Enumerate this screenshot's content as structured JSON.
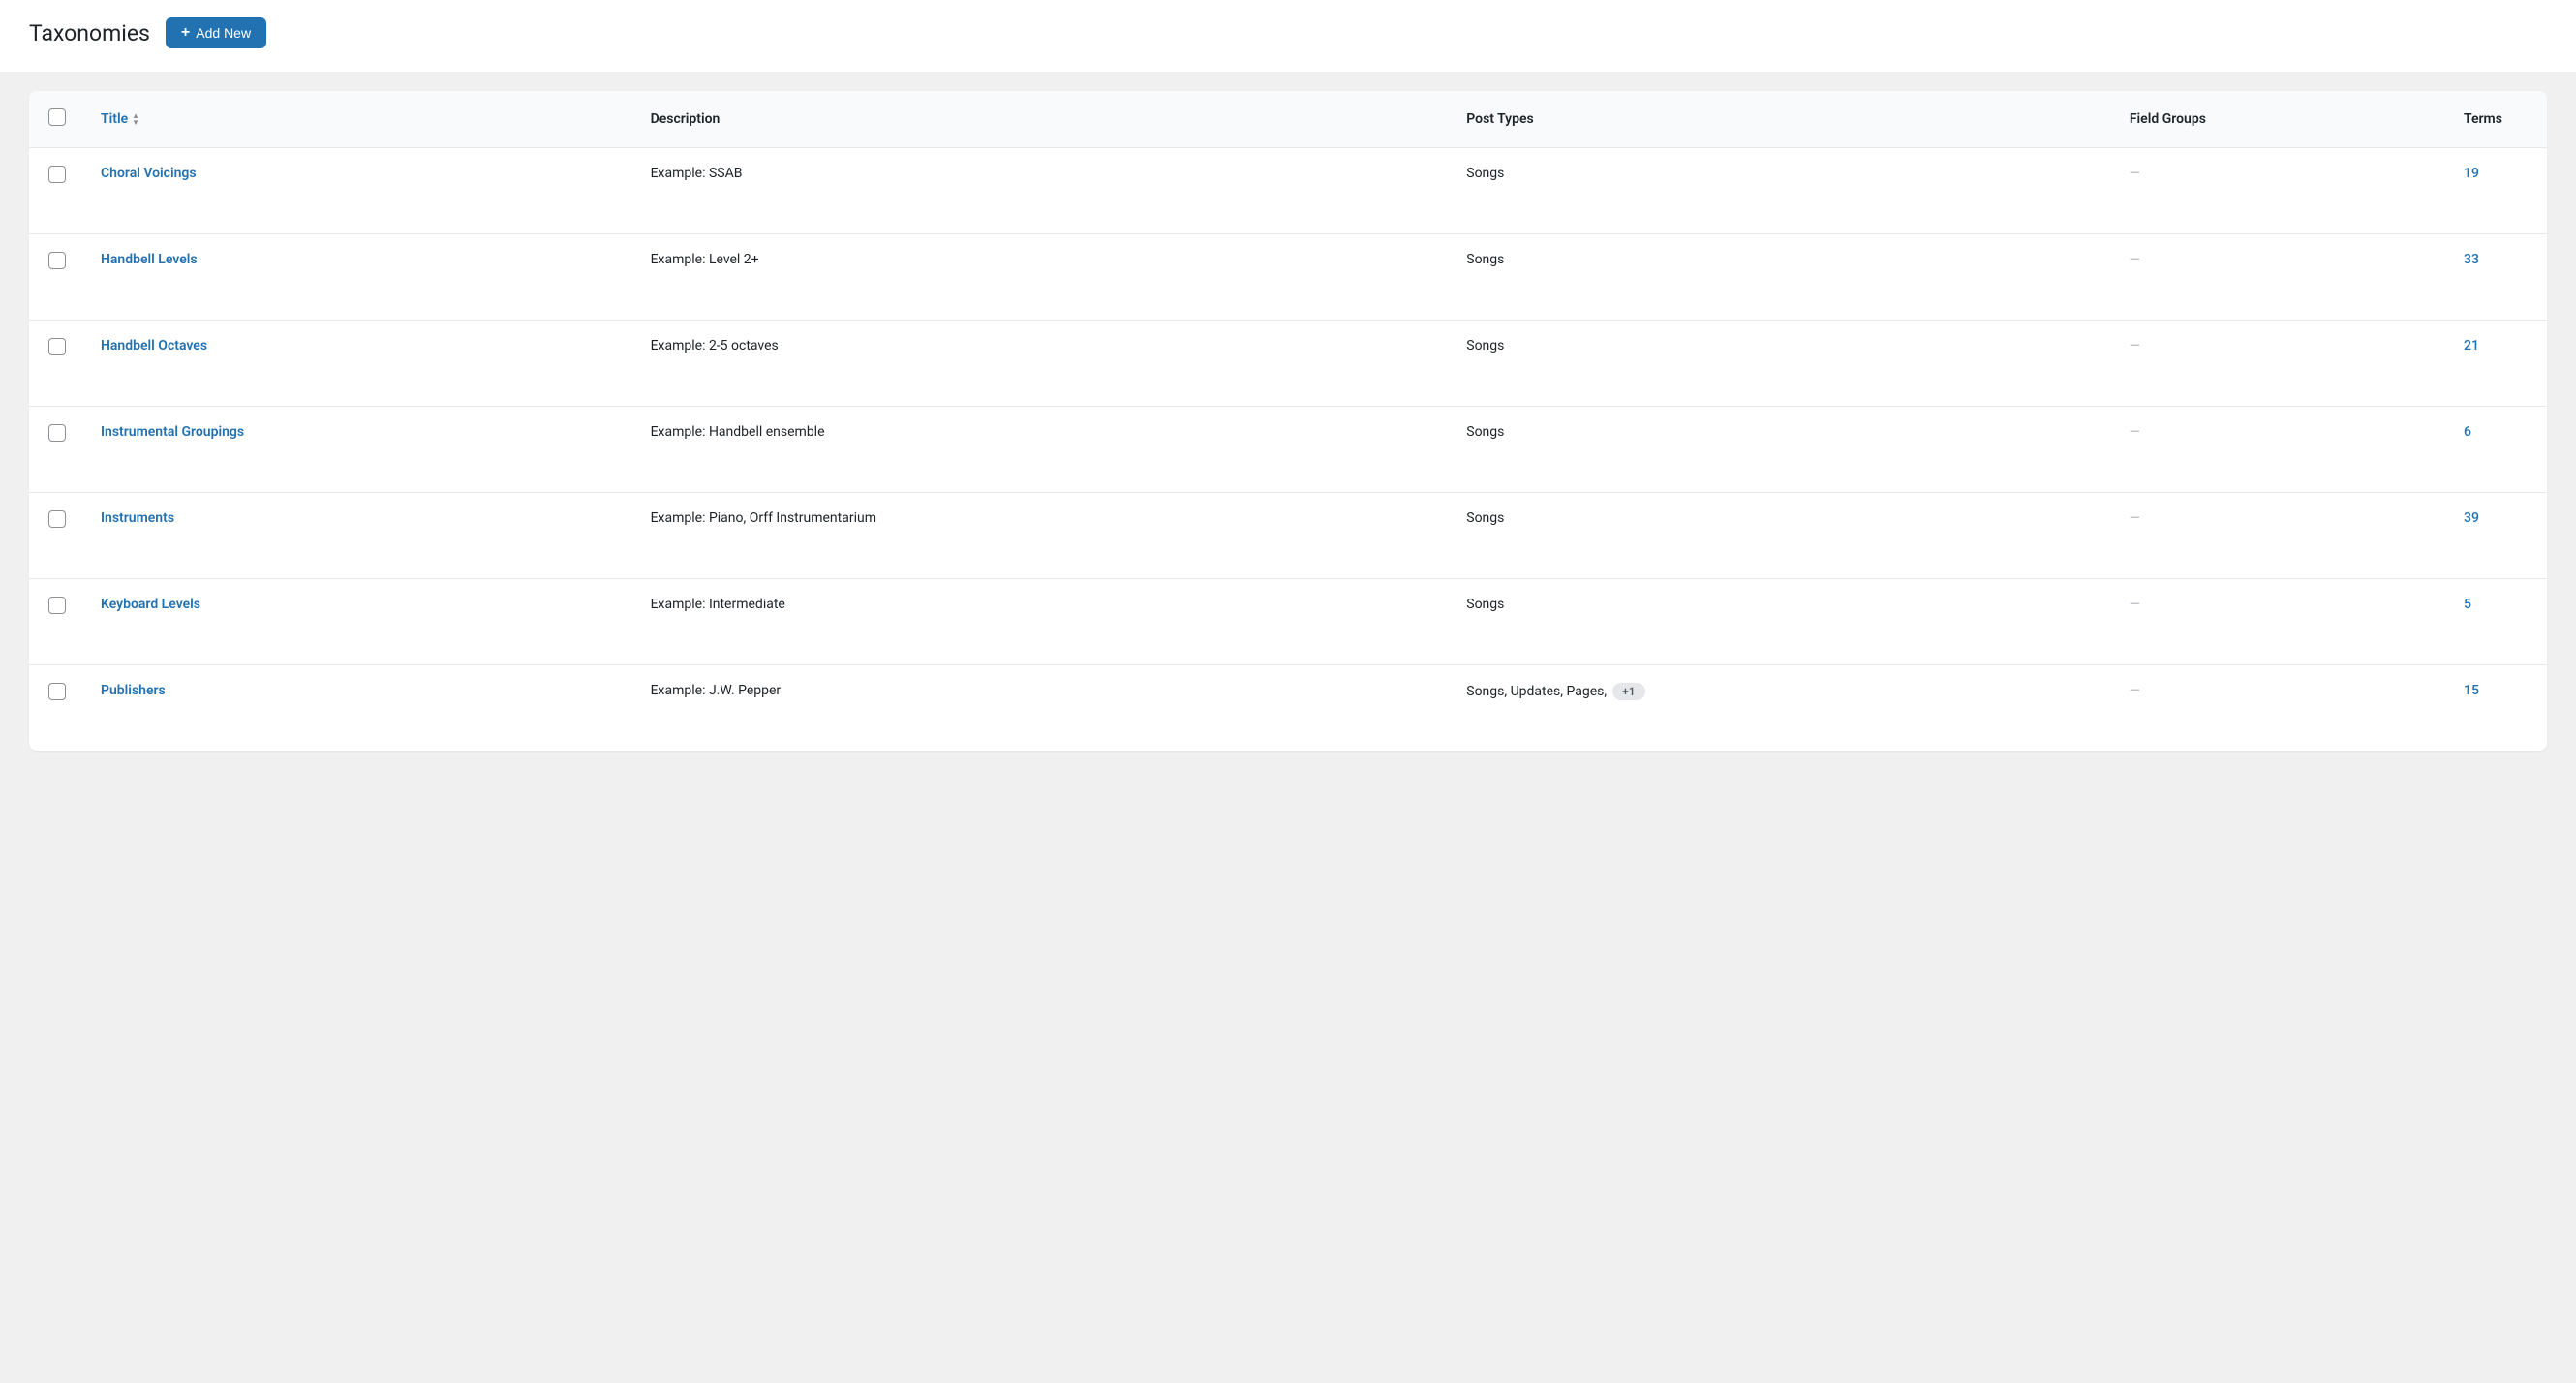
{
  "header": {
    "title": "Taxonomies",
    "add_new_label": "Add New"
  },
  "table": {
    "columns": {
      "title": "Title",
      "description": "Description",
      "post_types": "Post Types",
      "field_groups": "Field Groups",
      "terms": "Terms"
    },
    "rows": [
      {
        "title": "Choral Voicings",
        "description": "Example: SSAB",
        "post_types": "Songs",
        "post_types_badge": "",
        "field_groups": "—",
        "terms": "19"
      },
      {
        "title": "Handbell Levels",
        "description": "Example: Level 2+",
        "post_types": "Songs",
        "post_types_badge": "",
        "field_groups": "—",
        "terms": "33"
      },
      {
        "title": "Handbell Octaves",
        "description": "Example: 2-5 octaves",
        "post_types": "Songs",
        "post_types_badge": "",
        "field_groups": "—",
        "terms": "21"
      },
      {
        "title": "Instrumental Groupings",
        "description": "Example: Handbell ensemble",
        "post_types": "Songs",
        "post_types_badge": "",
        "field_groups": "—",
        "terms": "6"
      },
      {
        "title": "Instruments",
        "description": "Example: Piano, Orff Instrumentarium",
        "post_types": "Songs",
        "post_types_badge": "",
        "field_groups": "—",
        "terms": "39"
      },
      {
        "title": "Keyboard Levels",
        "description": "Example: Intermediate",
        "post_types": "Songs",
        "post_types_badge": "",
        "field_groups": "—",
        "terms": "5"
      },
      {
        "title": "Publishers",
        "description": "Example: J.W. Pepper",
        "post_types": "Songs, Updates, Pages,",
        "post_types_badge": "+1",
        "field_groups": "—",
        "terms": "15"
      }
    ]
  }
}
